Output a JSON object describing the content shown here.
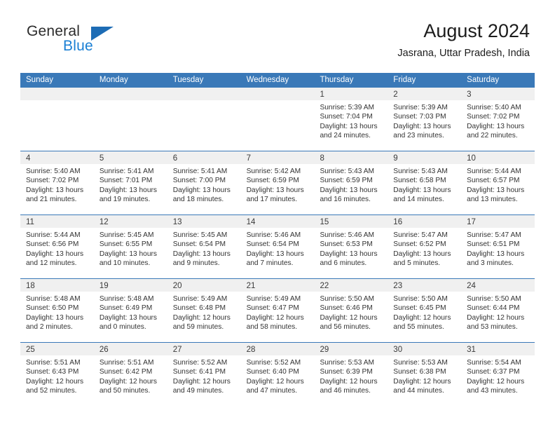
{
  "brand": {
    "name_part1": "General",
    "name_part2": "Blue",
    "triangle_color": "#1d6cb5",
    "blue_color": "#1a7fd4"
  },
  "header": {
    "title": "August 2024",
    "subtitle": "Jasrana, Uttar Pradesh, India",
    "accent_color": "#3a79b8"
  },
  "calendar": {
    "weekdays": [
      "Sunday",
      "Monday",
      "Tuesday",
      "Wednesday",
      "Thursday",
      "Friday",
      "Saturday"
    ],
    "weeks": [
      [
        {
          "day": "",
          "empty": true
        },
        {
          "day": "",
          "empty": true
        },
        {
          "day": "",
          "empty": true
        },
        {
          "day": "",
          "empty": true
        },
        {
          "day": "1",
          "sunrise": "Sunrise: 5:39 AM",
          "sunset": "Sunset: 7:04 PM",
          "daylight": "Daylight: 13 hours and 24 minutes."
        },
        {
          "day": "2",
          "sunrise": "Sunrise: 5:39 AM",
          "sunset": "Sunset: 7:03 PM",
          "daylight": "Daylight: 13 hours and 23 minutes."
        },
        {
          "day": "3",
          "sunrise": "Sunrise: 5:40 AM",
          "sunset": "Sunset: 7:02 PM",
          "daylight": "Daylight: 13 hours and 22 minutes."
        }
      ],
      [
        {
          "day": "4",
          "sunrise": "Sunrise: 5:40 AM",
          "sunset": "Sunset: 7:02 PM",
          "daylight": "Daylight: 13 hours and 21 minutes."
        },
        {
          "day": "5",
          "sunrise": "Sunrise: 5:41 AM",
          "sunset": "Sunset: 7:01 PM",
          "daylight": "Daylight: 13 hours and 19 minutes."
        },
        {
          "day": "6",
          "sunrise": "Sunrise: 5:41 AM",
          "sunset": "Sunset: 7:00 PM",
          "daylight": "Daylight: 13 hours and 18 minutes."
        },
        {
          "day": "7",
          "sunrise": "Sunrise: 5:42 AM",
          "sunset": "Sunset: 6:59 PM",
          "daylight": "Daylight: 13 hours and 17 minutes."
        },
        {
          "day": "8",
          "sunrise": "Sunrise: 5:43 AM",
          "sunset": "Sunset: 6:59 PM",
          "daylight": "Daylight: 13 hours and 16 minutes."
        },
        {
          "day": "9",
          "sunrise": "Sunrise: 5:43 AM",
          "sunset": "Sunset: 6:58 PM",
          "daylight": "Daylight: 13 hours and 14 minutes."
        },
        {
          "day": "10",
          "sunrise": "Sunrise: 5:44 AM",
          "sunset": "Sunset: 6:57 PM",
          "daylight": "Daylight: 13 hours and 13 minutes."
        }
      ],
      [
        {
          "day": "11",
          "sunrise": "Sunrise: 5:44 AM",
          "sunset": "Sunset: 6:56 PM",
          "daylight": "Daylight: 13 hours and 12 minutes."
        },
        {
          "day": "12",
          "sunrise": "Sunrise: 5:45 AM",
          "sunset": "Sunset: 6:55 PM",
          "daylight": "Daylight: 13 hours and 10 minutes."
        },
        {
          "day": "13",
          "sunrise": "Sunrise: 5:45 AM",
          "sunset": "Sunset: 6:54 PM",
          "daylight": "Daylight: 13 hours and 9 minutes."
        },
        {
          "day": "14",
          "sunrise": "Sunrise: 5:46 AM",
          "sunset": "Sunset: 6:54 PM",
          "daylight": "Daylight: 13 hours and 7 minutes."
        },
        {
          "day": "15",
          "sunrise": "Sunrise: 5:46 AM",
          "sunset": "Sunset: 6:53 PM",
          "daylight": "Daylight: 13 hours and 6 minutes."
        },
        {
          "day": "16",
          "sunrise": "Sunrise: 5:47 AM",
          "sunset": "Sunset: 6:52 PM",
          "daylight": "Daylight: 13 hours and 5 minutes."
        },
        {
          "day": "17",
          "sunrise": "Sunrise: 5:47 AM",
          "sunset": "Sunset: 6:51 PM",
          "daylight": "Daylight: 13 hours and 3 minutes."
        }
      ],
      [
        {
          "day": "18",
          "sunrise": "Sunrise: 5:48 AM",
          "sunset": "Sunset: 6:50 PM",
          "daylight": "Daylight: 13 hours and 2 minutes."
        },
        {
          "day": "19",
          "sunrise": "Sunrise: 5:48 AM",
          "sunset": "Sunset: 6:49 PM",
          "daylight": "Daylight: 13 hours and 0 minutes."
        },
        {
          "day": "20",
          "sunrise": "Sunrise: 5:49 AM",
          "sunset": "Sunset: 6:48 PM",
          "daylight": "Daylight: 12 hours and 59 minutes."
        },
        {
          "day": "21",
          "sunrise": "Sunrise: 5:49 AM",
          "sunset": "Sunset: 6:47 PM",
          "daylight": "Daylight: 12 hours and 58 minutes."
        },
        {
          "day": "22",
          "sunrise": "Sunrise: 5:50 AM",
          "sunset": "Sunset: 6:46 PM",
          "daylight": "Daylight: 12 hours and 56 minutes."
        },
        {
          "day": "23",
          "sunrise": "Sunrise: 5:50 AM",
          "sunset": "Sunset: 6:45 PM",
          "daylight": "Daylight: 12 hours and 55 minutes."
        },
        {
          "day": "24",
          "sunrise": "Sunrise: 5:50 AM",
          "sunset": "Sunset: 6:44 PM",
          "daylight": "Daylight: 12 hours and 53 minutes."
        }
      ],
      [
        {
          "day": "25",
          "sunrise": "Sunrise: 5:51 AM",
          "sunset": "Sunset: 6:43 PM",
          "daylight": "Daylight: 12 hours and 52 minutes."
        },
        {
          "day": "26",
          "sunrise": "Sunrise: 5:51 AM",
          "sunset": "Sunset: 6:42 PM",
          "daylight": "Daylight: 12 hours and 50 minutes."
        },
        {
          "day": "27",
          "sunrise": "Sunrise: 5:52 AM",
          "sunset": "Sunset: 6:41 PM",
          "daylight": "Daylight: 12 hours and 49 minutes."
        },
        {
          "day": "28",
          "sunrise": "Sunrise: 5:52 AM",
          "sunset": "Sunset: 6:40 PM",
          "daylight": "Daylight: 12 hours and 47 minutes."
        },
        {
          "day": "29",
          "sunrise": "Sunrise: 5:53 AM",
          "sunset": "Sunset: 6:39 PM",
          "daylight": "Daylight: 12 hours and 46 minutes."
        },
        {
          "day": "30",
          "sunrise": "Sunrise: 5:53 AM",
          "sunset": "Sunset: 6:38 PM",
          "daylight": "Daylight: 12 hours and 44 minutes."
        },
        {
          "day": "31",
          "sunrise": "Sunrise: 5:54 AM",
          "sunset": "Sunset: 6:37 PM",
          "daylight": "Daylight: 12 hours and 43 minutes."
        }
      ]
    ]
  }
}
